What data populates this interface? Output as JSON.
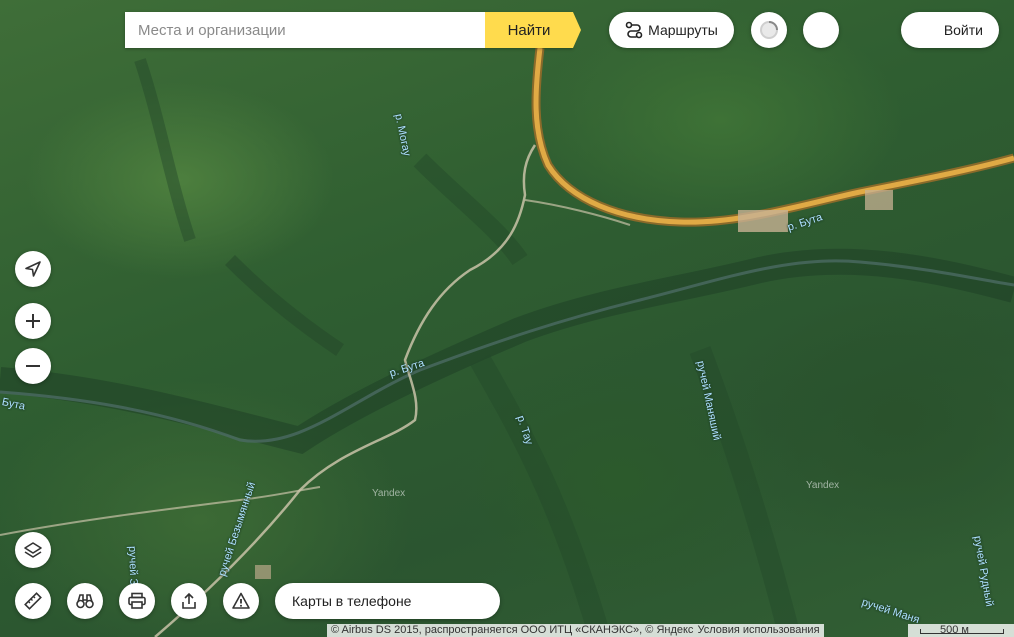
{
  "search": {
    "placeholder": "Места и организации",
    "button_label": "Найти"
  },
  "header": {
    "routes_label": "Маршруты",
    "login_label": "Войти"
  },
  "controls": {
    "location_icon": "location-arrow-icon",
    "zoom_in_icon": "plus-icon",
    "zoom_out_icon": "minus-icon",
    "layers_icon": "layers-icon",
    "ruler_icon": "ruler-icon",
    "panorama_icon": "binoculars-icon",
    "print_icon": "printer-icon",
    "share_icon": "share-icon",
    "report_icon": "warning-icon"
  },
  "phone_promo": {
    "label": "Карты в телефоне"
  },
  "map_labels": {
    "river_mogau": "р. Могау",
    "river_buta_1": "р. Бута",
    "river_buta_2": "р. Бута",
    "river_buta_3": "Бута",
    "river_tau": "р. Тау",
    "stream_maniyshiy": "ручей Маняший",
    "stream_bezymyanny": "ручей Безымянный",
    "stream_zaryadny": "ручей За",
    "stream_rudny": "ручей Рудный",
    "stream_manya_bottom": "ручей Маня",
    "watermark_1": "Yandex",
    "watermark_2": "Yandex"
  },
  "footer": {
    "copyright": "© Airbus DS 2015, распространяется ООО ИТЦ «СКАНЭКС», © Яндекс",
    "terms_link": "Условия использования",
    "scale_label": "500 м"
  },
  "colors": {
    "accent": "#ffdb4d",
    "highway": "#d9a441",
    "river_label": "#aee0ff"
  }
}
